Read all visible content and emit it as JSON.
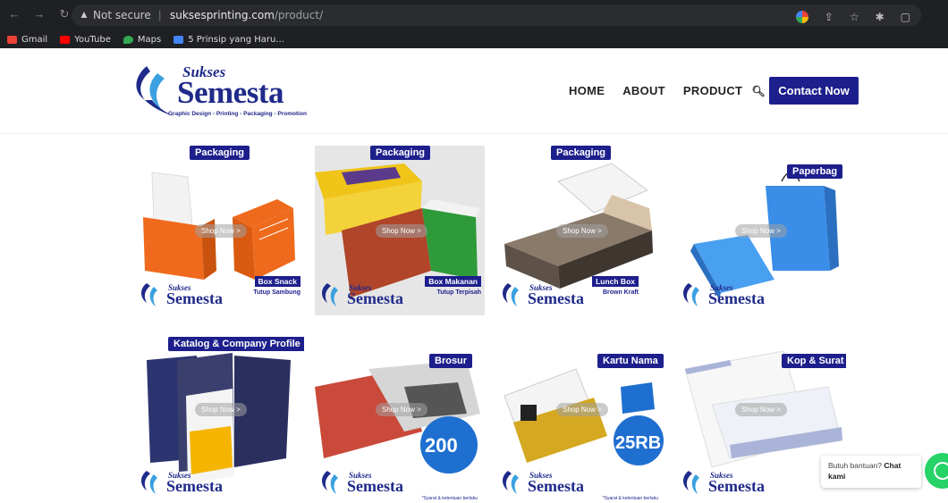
{
  "browser": {
    "security_label": "Not secure",
    "url_host": "suksesprinting.com",
    "url_path": "/product/",
    "bookmarks": [
      {
        "label": "Gmail",
        "color": "#ea4335"
      },
      {
        "label": "YouTube",
        "color": "#ff0000"
      },
      {
        "label": "Maps",
        "color": "#34a853"
      },
      {
        "label": "5 Prinsip yang Haru...",
        "color": "#4285f4"
      }
    ]
  },
  "site": {
    "logo_line1": "Sukses",
    "logo_line2": "Semesta",
    "logo_tagline": "Graphic Design - Printing - Packaging - Promotion",
    "nav": [
      "HOME",
      "ABOUT",
      "PRODUCT"
    ],
    "contact_label": "Contact Now",
    "brand_color": "#1d1f8c"
  },
  "products": [
    {
      "badge": "Packaging",
      "sub_a": "Box Snack",
      "sub_b": "Tutup Sambung",
      "shop": "Shop Now >"
    },
    {
      "badge": "Packaging",
      "sub_a": "Box Makanan",
      "sub_b": "Tutup Terpisah",
      "shop": "Shop Now >"
    },
    {
      "badge": "Packaging",
      "sub_a": "Lunch Box",
      "sub_b": "Brown Kraft",
      "shop": "Shop Now >"
    },
    {
      "badge": "Paperbag",
      "shop": "Shop Now >"
    },
    {
      "badge": "Katalog & Company Profile",
      "shop": "Shop Now >"
    },
    {
      "badge": "Brosur",
      "shop": "Shop Now >",
      "promo": "200",
      "fine": "*Syarat & ketentuan berlaku"
    },
    {
      "badge": "Kartu Nama",
      "shop": "Shop Now >",
      "promo": "25RB",
      "fine": "*Syarat & ketentuan berlaku"
    },
    {
      "badge": "Kop & Surat",
      "shop": "Shop Now >"
    }
  ],
  "mini_logo": {
    "line1": "Sukses",
    "line2": "Semesta"
  },
  "chat": {
    "text": "Butuh bantuan?",
    "bold": "Chat kami"
  }
}
